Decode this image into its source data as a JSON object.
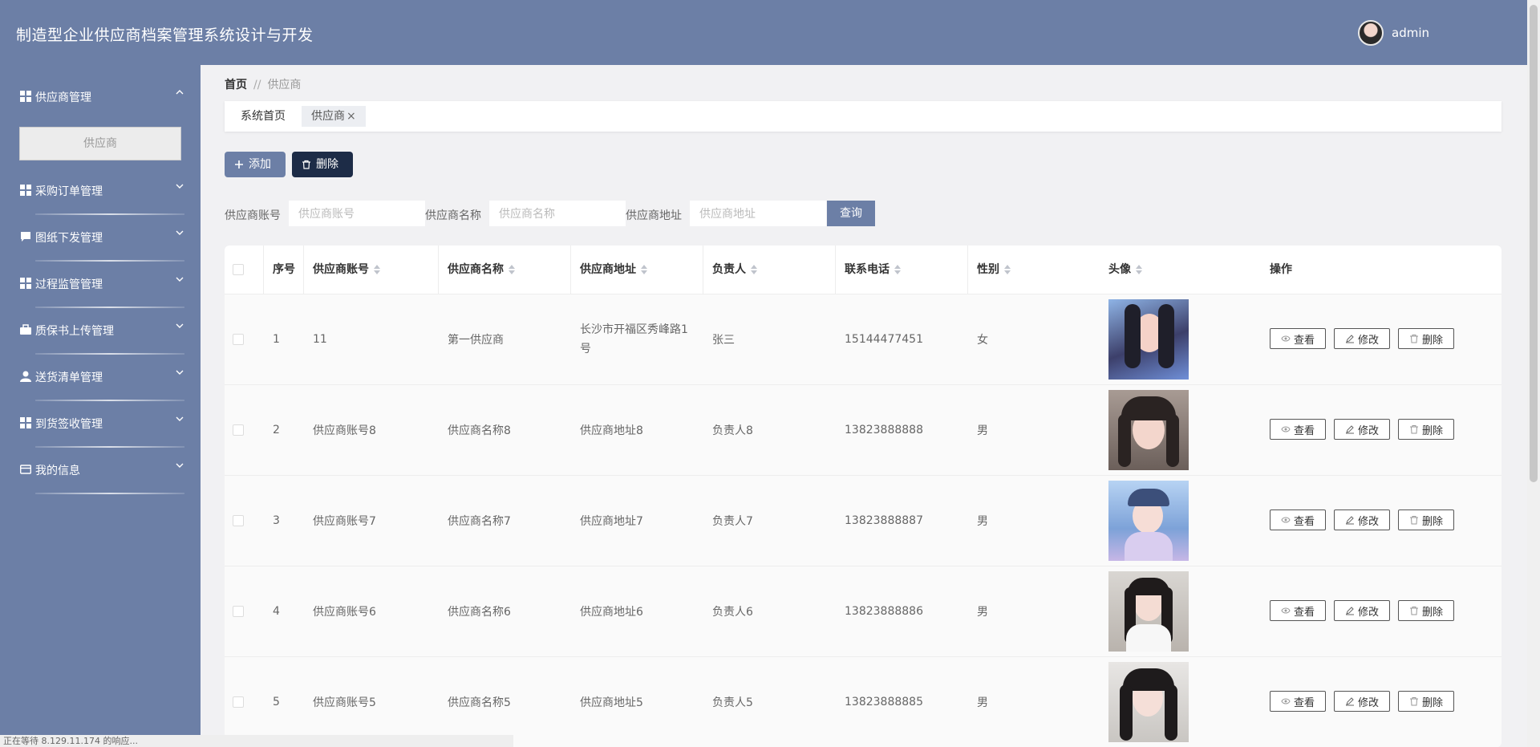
{
  "app": {
    "title": "制造型企业供应商档案管理系统设计与开发",
    "username": "admin"
  },
  "sidebar": {
    "items": [
      {
        "label": "供应商管理",
        "expanded": true,
        "icon": "grid-icon"
      },
      {
        "label": "采购订单管理",
        "icon": "grid-icon"
      },
      {
        "label": "图纸下发管理",
        "icon": "comment-icon"
      },
      {
        "label": "过程监管管理",
        "icon": "grid-icon"
      },
      {
        "label": "质保书上传管理",
        "icon": "briefcase-icon"
      },
      {
        "label": "送货清单管理",
        "icon": "user-icon"
      },
      {
        "label": "到货签收管理",
        "icon": "grid-icon"
      },
      {
        "label": "我的信息",
        "icon": "card-icon"
      }
    ],
    "submenu": {
      "label": "供应商"
    }
  },
  "breadcrumb": {
    "home": "首页",
    "sep": "//",
    "current": "供应商"
  },
  "tabs": {
    "home": "系统首页",
    "active": "供应商",
    "close": "×"
  },
  "toolbar": {
    "add_label": "添加",
    "delete_label": "删除"
  },
  "search": {
    "account_label": "供应商账号",
    "account_placeholder": "供应商账号",
    "name_label": "供应商名称",
    "name_placeholder": "供应商名称",
    "address_label": "供应商地址",
    "address_placeholder": "供应商地址",
    "query_label": "查询"
  },
  "table": {
    "headers": {
      "index": "序号",
      "account": "供应商账号",
      "name": "供应商名称",
      "address": "供应商地址",
      "contact": "负责人",
      "phone": "联系电话",
      "gender": "性别",
      "avatar": "头像",
      "ops": "操作"
    },
    "ops": {
      "view": "查看",
      "edit": "修改",
      "delete": "删除"
    },
    "rows": [
      {
        "index": "1",
        "account": "11",
        "name": "第一供应商",
        "address": "长沙市开福区秀峰路1号",
        "contact": "张三",
        "phone": "15144477451",
        "gender": "女"
      },
      {
        "index": "2",
        "account": "供应商账号8",
        "name": "供应商名称8",
        "address": "供应商地址8",
        "contact": "负责人8",
        "phone": "13823888888",
        "gender": "男"
      },
      {
        "index": "3",
        "account": "供应商账号7",
        "name": "供应商名称7",
        "address": "供应商地址7",
        "contact": "负责人7",
        "phone": "13823888887",
        "gender": "男"
      },
      {
        "index": "4",
        "account": "供应商账号6",
        "name": "供应商名称6",
        "address": "供应商地址6",
        "contact": "负责人6",
        "phone": "13823888886",
        "gender": "男"
      },
      {
        "index": "5",
        "account": "供应商账号5",
        "name": "供应商名称5",
        "address": "供应商地址5",
        "contact": "负责人5",
        "phone": "13823888885",
        "gender": "男"
      }
    ]
  },
  "status": {
    "text": "正在等待 8.129.11.174 的响应..."
  },
  "colors": {
    "primary": "#6c7fa6",
    "dark": "#1d2c47"
  }
}
